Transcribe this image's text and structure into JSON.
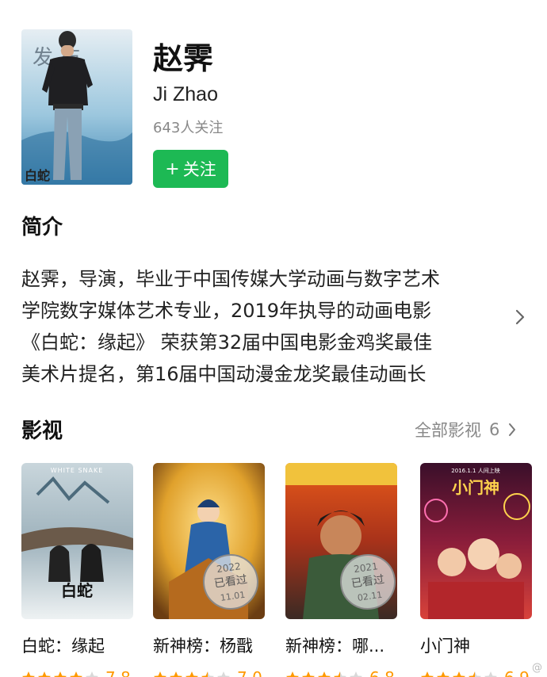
{
  "profile": {
    "name": "赵霁",
    "english_name": "Ji Zhao",
    "followers": "643人关注",
    "follow_button": "关注",
    "avatar_backdrop_text": "发  布",
    "avatar_logo_text": "白蛇"
  },
  "intro": {
    "title": "简介",
    "lines": [
      "赵霁，导演，毕业于中国传媒大学动画与数字艺术",
      "学院数字媒体艺术专业，2019年执导的动画电影",
      "《白蛇：缘起》 荣获第32届中国电影金鸡奖最佳",
      "美术片提名，第16届中国动漫金龙奖最佳动画长"
    ]
  },
  "movies": {
    "title": "影视",
    "all_label": "全部影视",
    "all_count": "6",
    "items": [
      {
        "title": "白蛇：缘起",
        "score": "7.8",
        "stars": 4,
        "poster_text": "WHITE SNAKE",
        "poster_logo": "白蛇",
        "watched": null
      },
      {
        "title": "新神榜：杨戬",
        "score": "7.0",
        "stars": 3.5,
        "poster_text": "",
        "poster_logo": "",
        "watched": {
          "year": "2022",
          "label": "已看过",
          "date": "11.01"
        }
      },
      {
        "title": "新神榜：哪...",
        "score": "6.8",
        "stars": 3.5,
        "poster_text": "",
        "poster_logo": "",
        "watched": {
          "year": "2021",
          "label": "已看过",
          "date": "02.11"
        }
      },
      {
        "title": "小门神",
        "score": "6.9",
        "stars": 3.5,
        "poster_text": "2016.1.1 人间上映",
        "poster_logo": "小门神",
        "watched": null
      }
    ]
  },
  "colors": {
    "accent_green": "#1db954",
    "star_orange": "#ff9900",
    "star_gray": "#d9d9d9"
  },
  "watermark": "@"
}
